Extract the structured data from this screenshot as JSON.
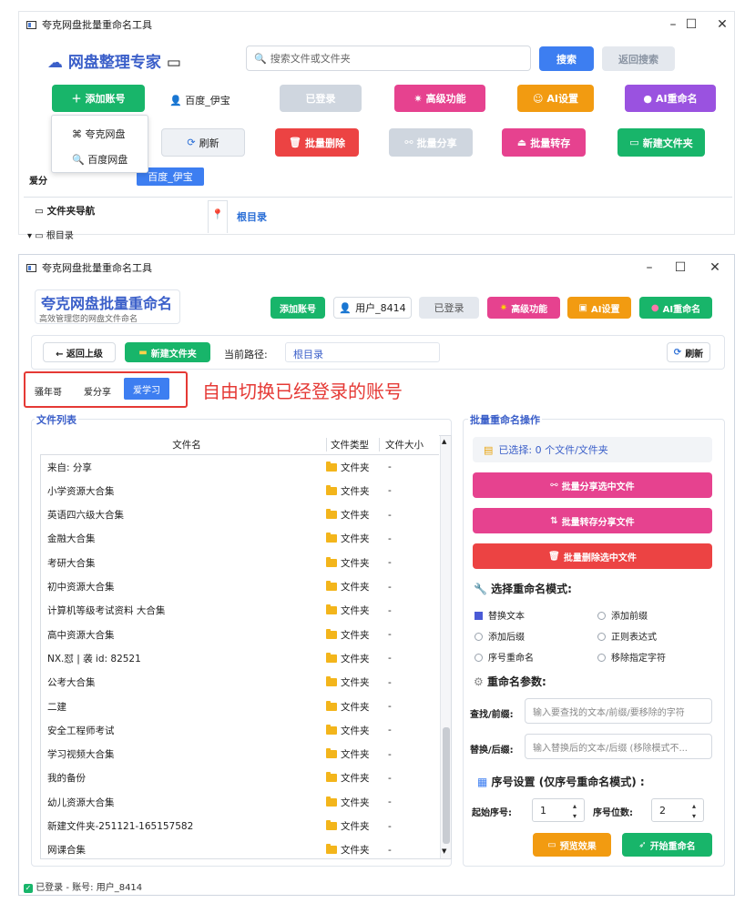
{
  "colors": {
    "green": "#18b56a",
    "pink": "#e6428f",
    "orange": "#f29b11",
    "purple": "#9a52e0",
    "red": "#ec4343",
    "blue": "#3d7ef1",
    "title_blue": "#3b5fc9"
  },
  "top": {
    "window_title": "夸克网盘批量重命名工具",
    "brand": "网盘整理专家",
    "search_placeholder": "搜索文件或文件夹",
    "search_btn": "搜索",
    "back_search_btn": "返回搜索",
    "add_account_btn": "添加账号",
    "user": "百度_伊宝",
    "logged_btn": "已登录",
    "advanced_btn": "高级功能",
    "ai_settings_btn": "AI设置",
    "ai_rename_btn": "AI重命名",
    "dropdown": [
      "夸克网盘",
      "百度网盘"
    ],
    "refresh_btn": "刷新",
    "batch_delete_btn": "批量删除",
    "batch_share_btn": "批量分享",
    "batch_transfer_btn": "批量转存",
    "new_folder_btn": "新建文件夹",
    "account_label": "爱分",
    "account_chip": "百度_伊宝",
    "folder_nav": "文件夹导航",
    "root_tab": "根目录",
    "tree_root": "根目录"
  },
  "main": {
    "window_title": "夸克网盘批量重命名工具",
    "app_title": "夸克网盘批量重命名",
    "app_subtitle": "高效管理您的网盘文件命名",
    "add_account_btn": "添加账号",
    "user": "用户_8414",
    "logged_btn": "已登录",
    "advanced_btn": "高级功能",
    "ai_settings_btn": "AI设置",
    "ai_rename_btn": "AI重命名",
    "back_btn": "← 返回上级",
    "new_folder_btn": "新建文件夹",
    "path_label": "当前路径:",
    "path_value": "根目录",
    "refresh_btn": "刷新",
    "accounts": [
      "骚年哥",
      "爱分享",
      "爱学习"
    ],
    "annotation": "自由切换已经登录的账号",
    "file_list_title": "文件列表",
    "columns": [
      "文件名",
      "文件类型",
      "文件大小"
    ],
    "files": [
      [
        "来自: 分享",
        "文件夹",
        "-"
      ],
      [
        "小学资源大合集",
        "文件夹",
        "-"
      ],
      [
        "英语四六级大合集",
        "文件夹",
        "-"
      ],
      [
        "金融大合集",
        "文件夹",
        "-"
      ],
      [
        "考研大合集",
        "文件夹",
        "-"
      ],
      [
        "初中资源大合集",
        "文件夹",
        "-"
      ],
      [
        "计算机等级考试资料 大合集",
        "文件夹",
        "-"
      ],
      [
        "高中资源大合集",
        "文件夹",
        "-"
      ],
      [
        "NX.怼 | 袭 id: 82521",
        "文件夹",
        "-"
      ],
      [
        "公考大合集",
        "文件夹",
        "-"
      ],
      [
        "二建",
        "文件夹",
        "-"
      ],
      [
        "安全工程师考试",
        "文件夹",
        "-"
      ],
      [
        "学习视频大合集",
        "文件夹",
        "-"
      ],
      [
        "我的备份",
        "文件夹",
        "-"
      ],
      [
        "幼儿资源大合集",
        "文件夹",
        "-"
      ],
      [
        "新建文件夹-251121-165157582",
        "文件夹",
        "-"
      ],
      [
        "网课合集",
        "文件夹",
        "-"
      ]
    ],
    "ops_title": "批量重命名操作",
    "selected": "已选择: 0 个文件/文件夹",
    "share_btn": "批量分享选中文件",
    "transfer_btn": "批量转存分享文件",
    "delete_btn": "批量删除选中文件",
    "mode_title": "选择重命名模式:",
    "modes": [
      "替换文本",
      "添加前缀",
      "添加后缀",
      "正则表达式",
      "序号重命名",
      "移除指定字符"
    ],
    "params_title": "重命名参数:",
    "find_label": "查找/前缀:",
    "find_placeholder": "输入要查找的文本/前缀/要移除的字符",
    "replace_label": "替换/后缀:",
    "replace_placeholder": "输入替换后的文本/后缀 (移除模式不...",
    "seq_title": "序号设置 (仅序号重命名模式) :",
    "start_label": "起始序号:",
    "start_value": "1",
    "digits_label": "序号位数:",
    "digits_value": "2",
    "preview_btn": "预览效果",
    "start_btn": "开始重命名",
    "status": "已登录 - 账号: 用户_8414"
  }
}
